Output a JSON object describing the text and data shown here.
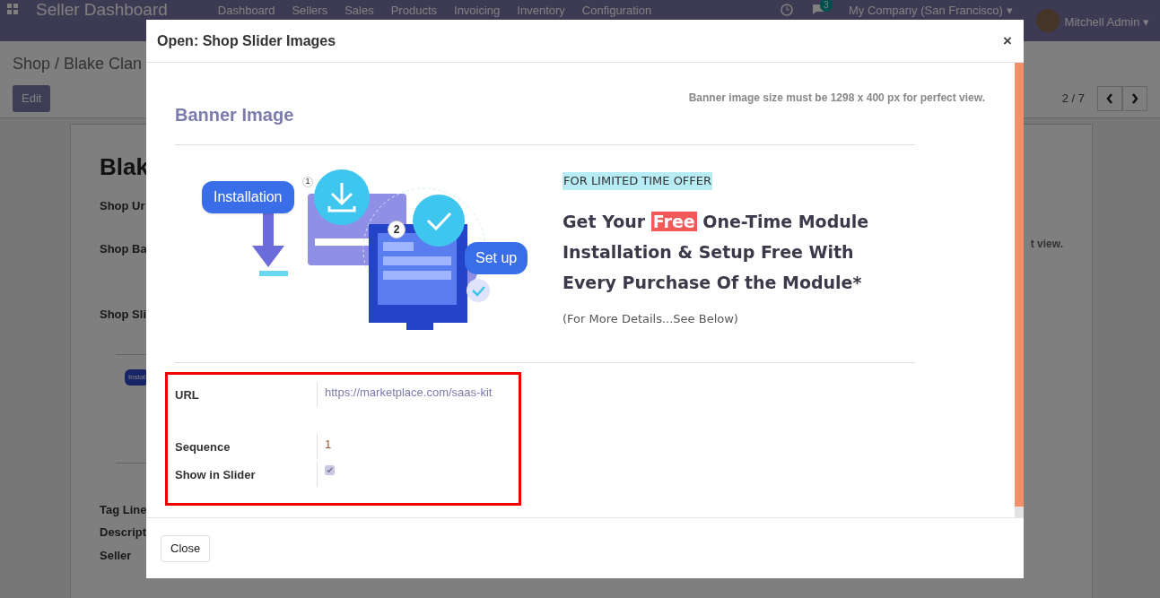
{
  "navbar": {
    "title": "Seller Dashboard",
    "menu": [
      "Dashboard",
      "Sellers",
      "Sales",
      "Products",
      "Invoicing",
      "Inventory",
      "Configuration"
    ],
    "chat_badge": "3",
    "company": "My Company (San Francisco)",
    "company_caret": "▾",
    "user": "Mitchell Admin",
    "user_caret": "▾"
  },
  "breadcrumb": "Shop / Blake Clan",
  "edit_button": "Edit",
  "pager": "2 / 7",
  "form_sheet": {
    "title": "Blak",
    "fields": [
      "Shop Ur",
      "Shop Ba",
      "Shop Sli"
    ],
    "slider_tag": "Instal",
    "note_fragment": "t view.",
    "lower_fields": [
      "Tag Line",
      "Descript",
      "Seller"
    ]
  },
  "dialog": {
    "title": "Open: Shop Slider Images",
    "close": "×",
    "heading": "Banner Image",
    "size_note": "Banner image size must be 1298 x 400 px for perfect view.",
    "banner": {
      "install_label": "Installation",
      "step_one": "1",
      "step_two": "2",
      "setup_label": "Set up",
      "offer_tag": "FOR LIMITED TIME OFFER",
      "headline_start": "Get Your ",
      "headline_highlight": "Free",
      "headline_end": " One-Time Module Installation & Setup Free With Every Purchase Of the Module*",
      "details": "(For More Details...See Below)"
    },
    "fields": [
      {
        "kind": "link",
        "label": "URL",
        "value": "https://marketplace.com/saas-kit"
      },
      {
        "kind": "number",
        "label": "Sequence",
        "value": "1"
      },
      {
        "kind": "checkbox",
        "label": "Show in Slider",
        "checked": true
      }
    ],
    "footer_button": "Close"
  }
}
